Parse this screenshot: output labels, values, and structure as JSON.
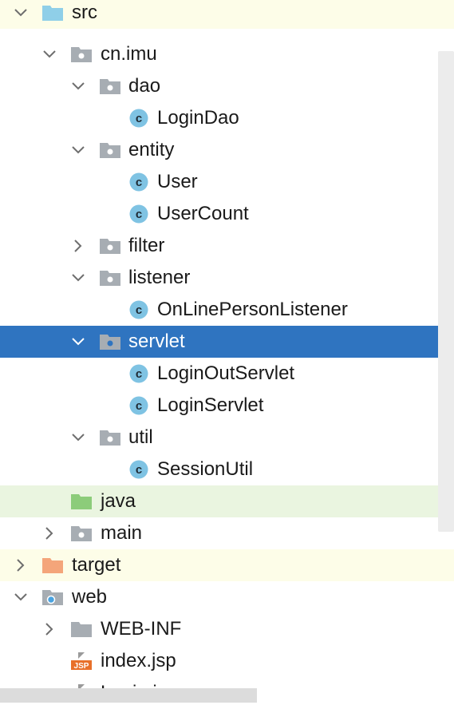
{
  "colors": {
    "selection": "#2f74c0",
    "folder_blue": "#8fcfe8",
    "folder_gray": "#a7adb3",
    "folder_green": "#8ccc7a",
    "folder_orange": "#f4a57a",
    "class_badge": "#7fc3e3",
    "jsp_orange": "#e8702a",
    "row_yellow": "#fdfde8",
    "row_green": "#eaf5e0"
  },
  "tree": {
    "items": [
      {
        "label": "src",
        "icon": "folder-blue-icon",
        "expander": "expanded"
      },
      {
        "label": "cn.imu",
        "icon": "package-icon",
        "expander": "expanded"
      },
      {
        "label": "dao",
        "icon": "package-icon",
        "expander": "expanded"
      },
      {
        "label": "LoginDao",
        "icon": "java-class-icon",
        "expander": "none"
      },
      {
        "label": "entity",
        "icon": "package-icon",
        "expander": "expanded"
      },
      {
        "label": "User",
        "icon": "java-class-icon",
        "expander": "none"
      },
      {
        "label": "UserCount",
        "icon": "java-class-icon",
        "expander": "none"
      },
      {
        "label": "filter",
        "icon": "package-icon",
        "expander": "collapsed"
      },
      {
        "label": "listener",
        "icon": "package-icon",
        "expander": "expanded"
      },
      {
        "label": "OnLinePersonListener",
        "icon": "java-class-icon",
        "expander": "none"
      },
      {
        "label": "servlet",
        "icon": "package-icon",
        "expander": "expanded",
        "selected": true
      },
      {
        "label": "LoginOutServlet",
        "icon": "java-class-icon",
        "expander": "none"
      },
      {
        "label": "LoginServlet",
        "icon": "java-class-icon",
        "expander": "none"
      },
      {
        "label": "util",
        "icon": "package-icon",
        "expander": "expanded"
      },
      {
        "label": "SessionUtil",
        "icon": "java-class-icon",
        "expander": "none"
      },
      {
        "label": "java",
        "icon": "folder-green-icon",
        "expander": "none"
      },
      {
        "label": "main",
        "icon": "package-icon",
        "expander": "collapsed"
      },
      {
        "label": "target",
        "icon": "folder-orange-icon",
        "expander": "collapsed"
      },
      {
        "label": "web",
        "icon": "web-folder-icon",
        "expander": "expanded"
      },
      {
        "label": "WEB-INF",
        "icon": "folder-gray-icon",
        "expander": "collapsed"
      },
      {
        "label": "index.jsp",
        "icon": "jsp-file-icon",
        "expander": "none"
      },
      {
        "label": "Login.jsp",
        "icon": "jsp-file-icon",
        "expander": "none"
      }
    ]
  }
}
